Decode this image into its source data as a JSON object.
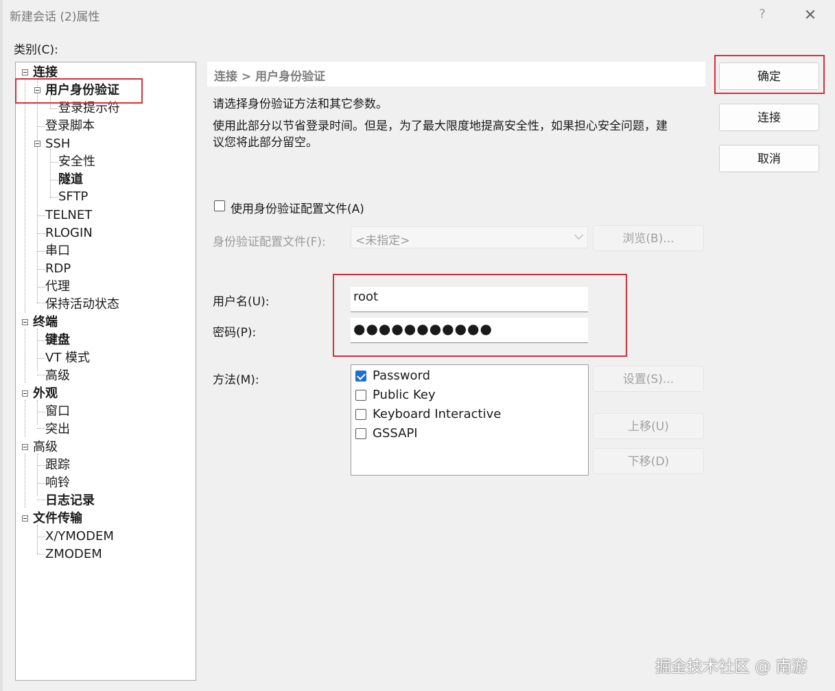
{
  "window": {
    "title": "新建会话 (2)属性",
    "help": "?",
    "close": "✕"
  },
  "category_label": "类别(C):",
  "tree": {
    "items": [
      {
        "label": "连接"
      },
      {
        "label": "用户身份验证"
      },
      {
        "label": "登录提示符"
      },
      {
        "label": "登录脚本"
      },
      {
        "label": "SSH"
      },
      {
        "label": "安全性"
      },
      {
        "label": "隧道"
      },
      {
        "label": "SFTP"
      },
      {
        "label": "TELNET"
      },
      {
        "label": "RLOGIN"
      },
      {
        "label": "串口"
      },
      {
        "label": "RDP"
      },
      {
        "label": "代理"
      },
      {
        "label": "保持活动状态"
      },
      {
        "label": "终端"
      },
      {
        "label": "键盘"
      },
      {
        "label": "VT 模式"
      },
      {
        "label": "高级"
      },
      {
        "label": "外观"
      },
      {
        "label": "窗口"
      },
      {
        "label": "突出"
      },
      {
        "label": "高级"
      },
      {
        "label": "跟踪"
      },
      {
        "label": "响铃"
      },
      {
        "label": "日志记录"
      },
      {
        "label": "文件传输"
      },
      {
        "label": "X/YMODEM"
      },
      {
        "label": "ZMODEM"
      }
    ]
  },
  "breadcrumb": "连接 > 用户身份验证",
  "description": {
    "line1": "请选择身份验证方法和其它参数。",
    "line2a": "使用此部分以节省登录时间。但是，为了最大限度地提高安全性，如果担心安全问题，建",
    "line2b": "议您将此部分留空。"
  },
  "profile": {
    "checkbox_label": "使用身份验证配置文件(A)",
    "field_label": "身份验证配置文件(F):",
    "select_value": "<未指定>",
    "browse_button": "浏览(B)..."
  },
  "credentials": {
    "username_label": "用户名(U):",
    "username_value": "root",
    "password_label": "密码(P):",
    "password_mask": "●●●●●●●●●●●"
  },
  "method": {
    "label": "方法(M):",
    "options": [
      {
        "label": "Password",
        "checked": true
      },
      {
        "label": "Public Key",
        "checked": false
      },
      {
        "label": "Keyboard Interactive",
        "checked": false
      },
      {
        "label": "GSSAPI",
        "checked": false
      }
    ],
    "settings_button": "设置(S)...",
    "move_up_button": "上移(U)",
    "move_down_button": "下移(D)"
  },
  "buttons": {
    "ok": "确定",
    "connect": "连接",
    "cancel": "取消"
  },
  "watermark": "掘金技术社区 @ 南游",
  "colors": {
    "highlight": "#d62e3a",
    "checkbox_checked": "#1f6fd0"
  }
}
